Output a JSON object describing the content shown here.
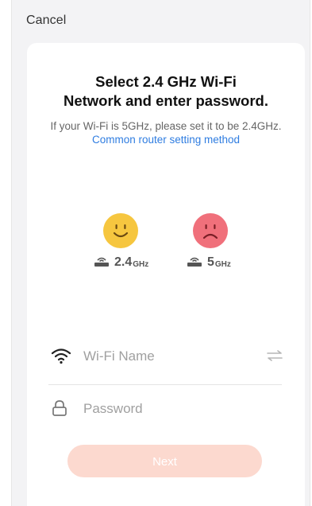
{
  "header": {
    "cancel_label": "Cancel"
  },
  "title_line1": "Select 2.4 GHz Wi-Fi",
  "title_line2": "Network and enter password.",
  "subtitle_text": "If your Wi-Fi is 5GHz, please set it to be 2.4GHz.",
  "subtitle_link": "Common router setting method",
  "bands": [
    {
      "value": "2.4",
      "unit": "GHz",
      "face": "happy-face-icon",
      "color": "#f6c63f"
    },
    {
      "value": "5",
      "unit": "GHz",
      "face": "sad-face-icon",
      "color": "#f0707b"
    }
  ],
  "form": {
    "wifi_placeholder": "Wi-Fi Name",
    "password_placeholder": "Password",
    "icons": [
      "wifi-icon",
      "lock-icon",
      "swap-icon",
      "router-icon"
    ]
  },
  "next_label": "Next",
  "colors": {
    "link": "#2f7de1",
    "next_button": "#fcd9cf"
  }
}
